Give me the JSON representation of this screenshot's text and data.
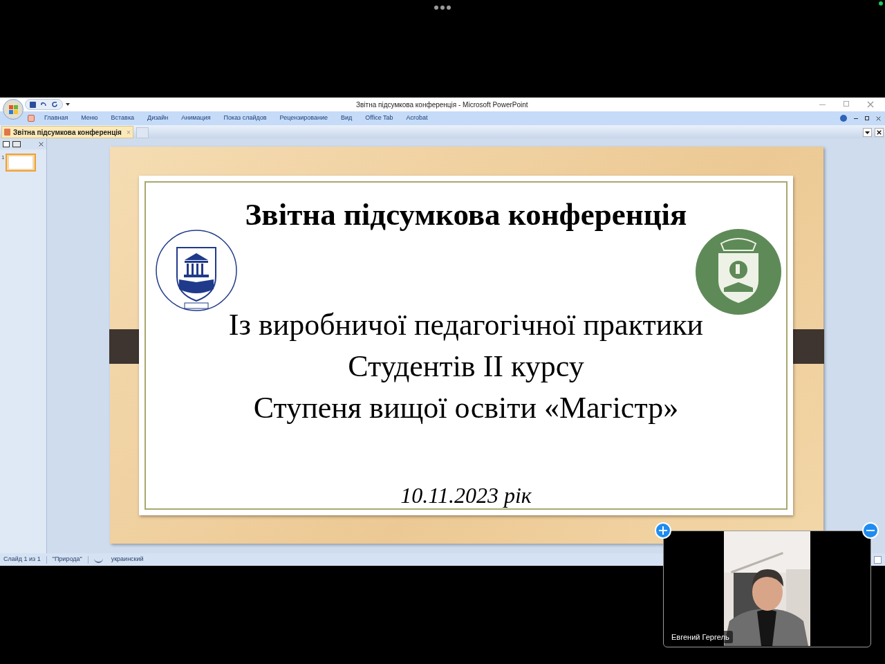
{
  "window": {
    "title": "Звітна підсумкова конференція - Microsoft PowerPoint"
  },
  "ribbon_tabs": [
    {
      "label": "Главная"
    },
    {
      "label": "Меню"
    },
    {
      "label": "Вставка"
    },
    {
      "label": "Дизайн"
    },
    {
      "label": "Анимация"
    },
    {
      "label": "Показ слайдов"
    },
    {
      "label": "Рецензирование"
    },
    {
      "label": "Вид"
    },
    {
      "label": "Office Tab"
    },
    {
      "label": "Acrobat"
    }
  ],
  "document_tab": {
    "label": "Звітна підсумкова конференція",
    "close": "×"
  },
  "thumbnails": [
    {
      "number": "1",
      "selected": true
    }
  ],
  "slide": {
    "title": "Звітна підсумкова конференція",
    "lines": [
      "Із виробничої педагогічної практики",
      "Студентів ІІ курсу",
      "Ступеня вищої освіти «Магістр»"
    ],
    "date": "10.11.2023 рік"
  },
  "status_bar": {
    "slide": "Слайд 1 из 1",
    "theme": "\"Природа\"",
    "language": "украинский"
  },
  "video_tile": {
    "name": "Евгений Гергель"
  }
}
